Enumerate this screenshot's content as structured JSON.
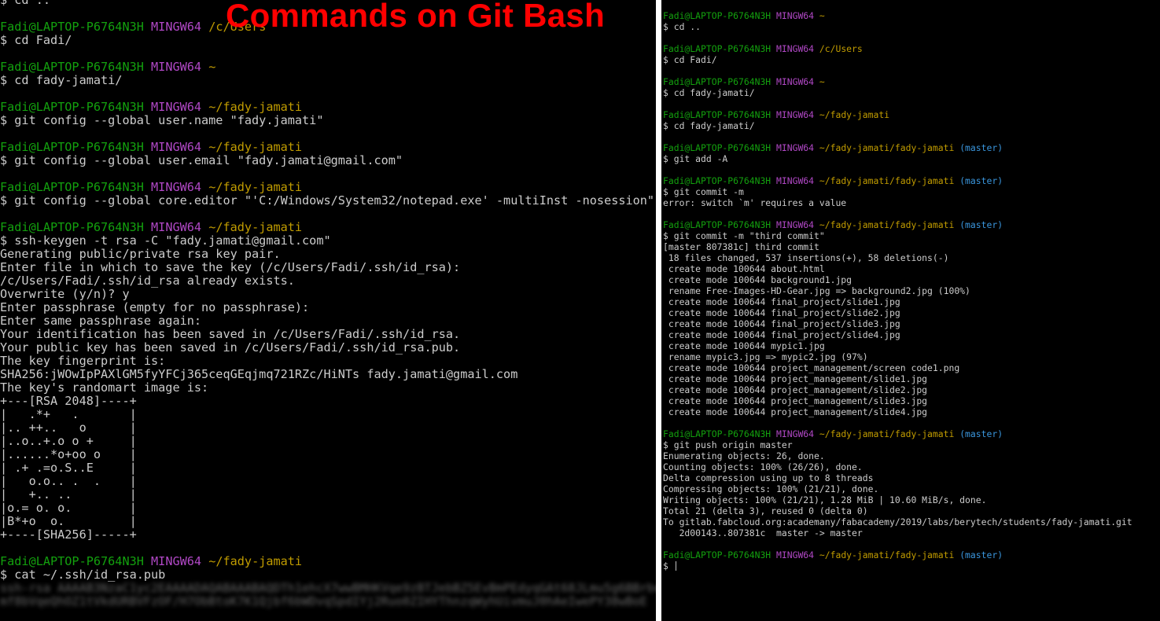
{
  "banner": "Commands on Git Bash",
  "colors": {
    "user": "#13a10e",
    "mingw": "#b148c6",
    "path": "#c19c00",
    "branch": "#3a96dd",
    "text": "#c0c0c0",
    "banner": "#ff0000"
  },
  "left_terminal": {
    "lines": [
      [
        {
          "t": "$ cd ..",
          "c": "t"
        }
      ],
      [
        {
          "t": "",
          "c": "t"
        }
      ],
      [
        {
          "t": "Fadi@LAPTOP-P6764N3H",
          "c": "u"
        },
        {
          "t": " ",
          "c": "t"
        },
        {
          "t": "MINGW64",
          "c": "m"
        },
        {
          "t": " ",
          "c": "t"
        },
        {
          "t": "/c/Users",
          "c": "p"
        }
      ],
      [
        {
          "t": "$ cd Fadi/",
          "c": "t"
        }
      ],
      [
        {
          "t": "",
          "c": "t"
        }
      ],
      [
        {
          "t": "Fadi@LAPTOP-P6764N3H",
          "c": "u"
        },
        {
          "t": " ",
          "c": "t"
        },
        {
          "t": "MINGW64",
          "c": "m"
        },
        {
          "t": " ",
          "c": "t"
        },
        {
          "t": "~",
          "c": "p"
        }
      ],
      [
        {
          "t": "$ cd fady-jamati/",
          "c": "t"
        }
      ],
      [
        {
          "t": "",
          "c": "t"
        }
      ],
      [
        {
          "t": "Fadi@LAPTOP-P6764N3H",
          "c": "u"
        },
        {
          "t": " ",
          "c": "t"
        },
        {
          "t": "MINGW64",
          "c": "m"
        },
        {
          "t": " ",
          "c": "t"
        },
        {
          "t": "~/fady-jamati",
          "c": "p"
        }
      ],
      [
        {
          "t": "$ git config --global user.name \"fady.jamati\"",
          "c": "t"
        }
      ],
      [
        {
          "t": "",
          "c": "t"
        }
      ],
      [
        {
          "t": "Fadi@LAPTOP-P6764N3H",
          "c": "u"
        },
        {
          "t": " ",
          "c": "t"
        },
        {
          "t": "MINGW64",
          "c": "m"
        },
        {
          "t": " ",
          "c": "t"
        },
        {
          "t": "~/fady-jamati",
          "c": "p"
        }
      ],
      [
        {
          "t": "$ git config --global user.email \"fady.jamati@gmail.com\"",
          "c": "t"
        }
      ],
      [
        {
          "t": "",
          "c": "t"
        }
      ],
      [
        {
          "t": "Fadi@LAPTOP-P6764N3H",
          "c": "u"
        },
        {
          "t": " ",
          "c": "t"
        },
        {
          "t": "MINGW64",
          "c": "m"
        },
        {
          "t": " ",
          "c": "t"
        },
        {
          "t": "~/fady-jamati",
          "c": "p"
        }
      ],
      [
        {
          "t": "$ git config --global core.editor \"'C:/Windows/System32/notepad.exe' -multiInst -nosession\"",
          "c": "t"
        }
      ],
      [
        {
          "t": "",
          "c": "t"
        }
      ],
      [
        {
          "t": "Fadi@LAPTOP-P6764N3H",
          "c": "u"
        },
        {
          "t": " ",
          "c": "t"
        },
        {
          "t": "MINGW64",
          "c": "m"
        },
        {
          "t": " ",
          "c": "t"
        },
        {
          "t": "~/fady-jamati",
          "c": "p"
        }
      ],
      [
        {
          "t": "$ ssh-keygen -t rsa -C \"fady.jamati@gmail.com\"",
          "c": "t"
        }
      ],
      [
        {
          "t": "Generating public/private rsa key pair.",
          "c": "t"
        }
      ],
      [
        {
          "t": "Enter file in which to save the key (/c/Users/Fadi/.ssh/id_rsa):",
          "c": "t"
        }
      ],
      [
        {
          "t": "/c/Users/Fadi/.ssh/id_rsa already exists.",
          "c": "t"
        }
      ],
      [
        {
          "t": "Overwrite (y/n)? y",
          "c": "t"
        }
      ],
      [
        {
          "t": "Enter passphrase (empty for no passphrase):",
          "c": "t"
        }
      ],
      [
        {
          "t": "Enter same passphrase again:",
          "c": "t"
        }
      ],
      [
        {
          "t": "Your identification has been saved in /c/Users/Fadi/.ssh/id_rsa.",
          "c": "t"
        }
      ],
      [
        {
          "t": "Your public key has been saved in /c/Users/Fadi/.ssh/id_rsa.pub.",
          "c": "t"
        }
      ],
      [
        {
          "t": "The key fingerprint is:",
          "c": "t"
        }
      ],
      [
        {
          "t": "SHA256:jWOwIpPAXlGM5fyYFCj365ceqGEqjmq721RZc/HiNTs fady.jamati@gmail.com",
          "c": "t"
        }
      ],
      [
        {
          "t": "The key's randomart image is:",
          "c": "t"
        }
      ],
      [
        {
          "t": "+---[RSA 2048]----+",
          "c": "t"
        }
      ],
      [
        {
          "t": "|   .*+   .       |",
          "c": "t"
        }
      ],
      [
        {
          "t": "|.. ++..   o      |",
          "c": "t"
        }
      ],
      [
        {
          "t": "|..o..+.o o +     |",
          "c": "t"
        }
      ],
      [
        {
          "t": "|......*o+oo o    |",
          "c": "t"
        }
      ],
      [
        {
          "t": "| .+ .=o.S..E     |",
          "c": "t"
        }
      ],
      [
        {
          "t": "|   o.o.. .  .    |",
          "c": "t"
        }
      ],
      [
        {
          "t": "|   +.. ..        |",
          "c": "t"
        }
      ],
      [
        {
          "t": "|o.= o. o.        |",
          "c": "t"
        }
      ],
      [
        {
          "t": "|B*+o  o.         |",
          "c": "t"
        }
      ],
      [
        {
          "t": "+----[SHA256]-----+",
          "c": "t"
        }
      ],
      [
        {
          "t": "",
          "c": "t"
        }
      ],
      [
        {
          "t": "Fadi@LAPTOP-P6764N3H",
          "c": "u"
        },
        {
          "t": " ",
          "c": "t"
        },
        {
          "t": "MINGW64",
          "c": "m"
        },
        {
          "t": " ",
          "c": "t"
        },
        {
          "t": "~/fady-jamati",
          "c": "p"
        }
      ],
      [
        {
          "t": "$ cat ~/.ssh/id_rsa.pub",
          "c": "t"
        }
      ],
      [
        {
          "t": "ssh-rsa AAAAB3NzaC1yc2EAAAADAQABAAABAQDTh1ehcX7wwBMHKVqe9zBTJebBZ5EvBmPEdyqGAt68JLmu5g6BBrbe",
          "c": "blur"
        }
      ],
      [
        {
          "t": "mf8bVqeQhOZ1tVkdURBVFzOF/H7ObBtoK7K1Qjbf6bWDvqSpdIYj2Ruo0ZIHYThnzqWyhUivmuJ0hAeIwePY38wBoE",
          "c": "blur"
        }
      ]
    ]
  },
  "right_terminal": {
    "lines": [
      [
        {
          "t": "Fadi@LAPTOP-P6764N3H",
          "c": "u"
        },
        {
          "t": " ",
          "c": "t"
        },
        {
          "t": "MINGW64",
          "c": "m"
        },
        {
          "t": " ",
          "c": "t"
        },
        {
          "t": "~",
          "c": "p"
        }
      ],
      [
        {
          "t": "$ cd ..",
          "c": "t"
        }
      ],
      [
        {
          "t": "",
          "c": "t"
        }
      ],
      [
        {
          "t": "Fadi@LAPTOP-P6764N3H",
          "c": "u"
        },
        {
          "t": " ",
          "c": "t"
        },
        {
          "t": "MINGW64",
          "c": "m"
        },
        {
          "t": " ",
          "c": "t"
        },
        {
          "t": "/c/Users",
          "c": "p"
        }
      ],
      [
        {
          "t": "$ cd Fadi/",
          "c": "t"
        }
      ],
      [
        {
          "t": "",
          "c": "t"
        }
      ],
      [
        {
          "t": "Fadi@LAPTOP-P6764N3H",
          "c": "u"
        },
        {
          "t": " ",
          "c": "t"
        },
        {
          "t": "MINGW64",
          "c": "m"
        },
        {
          "t": " ",
          "c": "t"
        },
        {
          "t": "~",
          "c": "p"
        }
      ],
      [
        {
          "t": "$ cd fady-jamati/",
          "c": "t"
        }
      ],
      [
        {
          "t": "",
          "c": "t"
        }
      ],
      [
        {
          "t": "Fadi@LAPTOP-P6764N3H",
          "c": "u"
        },
        {
          "t": " ",
          "c": "t"
        },
        {
          "t": "MINGW64",
          "c": "m"
        },
        {
          "t": " ",
          "c": "t"
        },
        {
          "t": "~/fady-jamati",
          "c": "p"
        }
      ],
      [
        {
          "t": "$ cd fady-jamati/",
          "c": "t"
        }
      ],
      [
        {
          "t": "",
          "c": "t"
        }
      ],
      [
        {
          "t": "Fadi@LAPTOP-P6764N3H",
          "c": "u"
        },
        {
          "t": " ",
          "c": "t"
        },
        {
          "t": "MINGW64",
          "c": "m"
        },
        {
          "t": " ",
          "c": "t"
        },
        {
          "t": "~/fady-jamati/fady-jamati",
          "c": "p"
        },
        {
          "t": " ",
          "c": "t"
        },
        {
          "t": "(master)",
          "c": "b"
        }
      ],
      [
        {
          "t": "$ git add -A",
          "c": "t"
        }
      ],
      [
        {
          "t": "",
          "c": "t"
        }
      ],
      [
        {
          "t": "Fadi@LAPTOP-P6764N3H",
          "c": "u"
        },
        {
          "t": " ",
          "c": "t"
        },
        {
          "t": "MINGW64",
          "c": "m"
        },
        {
          "t": " ",
          "c": "t"
        },
        {
          "t": "~/fady-jamati/fady-jamati",
          "c": "p"
        },
        {
          "t": " ",
          "c": "t"
        },
        {
          "t": "(master)",
          "c": "b"
        }
      ],
      [
        {
          "t": "$ git commit -m",
          "c": "t"
        }
      ],
      [
        {
          "t": "error: switch `m' requires a value",
          "c": "t"
        }
      ],
      [
        {
          "t": "",
          "c": "t"
        }
      ],
      [
        {
          "t": "Fadi@LAPTOP-P6764N3H",
          "c": "u"
        },
        {
          "t": " ",
          "c": "t"
        },
        {
          "t": "MINGW64",
          "c": "m"
        },
        {
          "t": " ",
          "c": "t"
        },
        {
          "t": "~/fady-jamati/fady-jamati",
          "c": "p"
        },
        {
          "t": " ",
          "c": "t"
        },
        {
          "t": "(master)",
          "c": "b"
        }
      ],
      [
        {
          "t": "$ git commit -m \"third commit\"",
          "c": "t"
        }
      ],
      [
        {
          "t": "[master 807381c] third commit",
          "c": "t"
        }
      ],
      [
        {
          "t": " 18 files changed, 537 insertions(+), 58 deletions(-)",
          "c": "t"
        }
      ],
      [
        {
          "t": " create mode 100644 about.html",
          "c": "t"
        }
      ],
      [
        {
          "t": " create mode 100644 background1.jpg",
          "c": "t"
        }
      ],
      [
        {
          "t": " rename Free-Images-HD-Gear.jpg => background2.jpg (100%)",
          "c": "t"
        }
      ],
      [
        {
          "t": " create mode 100644 final_project/slide1.jpg",
          "c": "t"
        }
      ],
      [
        {
          "t": " create mode 100644 final_project/slide2.jpg",
          "c": "t"
        }
      ],
      [
        {
          "t": " create mode 100644 final_project/slide3.jpg",
          "c": "t"
        }
      ],
      [
        {
          "t": " create mode 100644 final_project/slide4.jpg",
          "c": "t"
        }
      ],
      [
        {
          "t": " create mode 100644 mypic1.jpg",
          "c": "t"
        }
      ],
      [
        {
          "t": " rename mypic3.jpg => mypic2.jpg (97%)",
          "c": "t"
        }
      ],
      [
        {
          "t": " create mode 100644 project_management/screen code1.png",
          "c": "t"
        }
      ],
      [
        {
          "t": " create mode 100644 project_management/slide1.jpg",
          "c": "t"
        }
      ],
      [
        {
          "t": " create mode 100644 project_management/slide2.jpg",
          "c": "t"
        }
      ],
      [
        {
          "t": " create mode 100644 project_management/slide3.jpg",
          "c": "t"
        }
      ],
      [
        {
          "t": " create mode 100644 project_management/slide4.jpg",
          "c": "t"
        }
      ],
      [
        {
          "t": "",
          "c": "t"
        }
      ],
      [
        {
          "t": "Fadi@LAPTOP-P6764N3H",
          "c": "u"
        },
        {
          "t": " ",
          "c": "t"
        },
        {
          "t": "MINGW64",
          "c": "m"
        },
        {
          "t": " ",
          "c": "t"
        },
        {
          "t": "~/fady-jamati/fady-jamati",
          "c": "p"
        },
        {
          "t": " ",
          "c": "t"
        },
        {
          "t": "(master)",
          "c": "b"
        }
      ],
      [
        {
          "t": "$ git push origin master",
          "c": "t"
        }
      ],
      [
        {
          "t": "Enumerating objects: 26, done.",
          "c": "t"
        }
      ],
      [
        {
          "t": "Counting objects: 100% (26/26), done.",
          "c": "t"
        }
      ],
      [
        {
          "t": "Delta compression using up to 8 threads",
          "c": "t"
        }
      ],
      [
        {
          "t": "Compressing objects: 100% (21/21), done.",
          "c": "t"
        }
      ],
      [
        {
          "t": "Writing objects: 100% (21/21), 1.28 MiB | 10.60 MiB/s, done.",
          "c": "t"
        }
      ],
      [
        {
          "t": "Total 21 (delta 3), reused 0 (delta 0)",
          "c": "t"
        }
      ],
      [
        {
          "t": "To gitlab.fabcloud.org:academany/fabacademy/2019/labs/berytech/students/fady-jamati.git",
          "c": "t"
        }
      ],
      [
        {
          "t": "   2d00143..807381c  master -> master",
          "c": "t"
        }
      ],
      [
        {
          "t": "",
          "c": "t"
        }
      ],
      [
        {
          "t": "Fadi@LAPTOP-P6764N3H",
          "c": "u"
        },
        {
          "t": " ",
          "c": "t"
        },
        {
          "t": "MINGW64",
          "c": "m"
        },
        {
          "t": " ",
          "c": "t"
        },
        {
          "t": "~/fady-jamati/fady-jamati",
          "c": "p"
        },
        {
          "t": " ",
          "c": "t"
        },
        {
          "t": "(master)",
          "c": "b"
        }
      ],
      [
        {
          "t": "$ ",
          "c": "t",
          "cursor": true
        }
      ]
    ]
  }
}
